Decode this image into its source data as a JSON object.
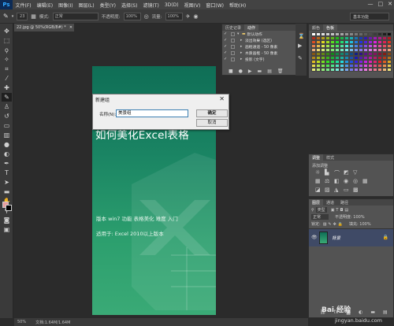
{
  "app": {
    "logo": "Ps",
    "menu": [
      "文件(F)",
      "编辑(E)",
      "图像(I)",
      "图层(L)",
      "类型(Y)",
      "选择(S)",
      "滤镜(T)",
      "3D(D)",
      "视图(V)",
      "窗口(W)",
      "帮助(H)"
    ],
    "window_controls": [
      "—",
      "□",
      "✕"
    ]
  },
  "options": {
    "brush_size": "23",
    "mode_label": "模式:",
    "mode_value": "正常",
    "opacity_label": "不透明度:",
    "opacity_value": "100%",
    "flow_label": "流量:",
    "flow_value": "100%",
    "workspace": "基本功能"
  },
  "document": {
    "tab": "22.jpg @ 50%(RGB/8#) *",
    "canvas_title": "如何美化Excel表格",
    "canvas_line1": "版本 win7   功能 表格美化   难度 入门",
    "canvas_line2": "适用于:  Excel 2010以上版本"
  },
  "dialog": {
    "title": "新建组",
    "close": "✕",
    "name_label": "名称(N):",
    "name_value": "美景组",
    "ok": "确定",
    "cancel": "取消"
  },
  "history": {
    "tabs": [
      "历史记录",
      "动作"
    ],
    "rows": [
      {
        "check": "✓",
        "arrow": "▾",
        "text": "默认动作"
      },
      {
        "check": "✓",
        "arrow": "▸",
        "text": "淡出效果 (选区)"
      },
      {
        "check": "✓",
        "arrow": "▸",
        "text": "画框通道 - 50 像素"
      },
      {
        "check": "✓",
        "arrow": "▸",
        "text": "木质画框 - 50 像素"
      },
      {
        "check": "✓",
        "arrow": "▸",
        "text": "投影 (文字)"
      }
    ]
  },
  "swatches": {
    "tabs": [
      "颜色",
      "色板"
    ]
  },
  "adjustments": {
    "tabs": [
      "调整",
      "样式"
    ],
    "subtitle": "添加调整"
  },
  "layers": {
    "tabs": [
      "图层",
      "通道",
      "路径"
    ],
    "filter_label": "类型",
    "blend_mode": "正常",
    "opacity": "不透明度: 100%",
    "lock_label": "锁定:",
    "fill": "填充: 100%",
    "layer_name": "背景"
  },
  "status": {
    "zoom": "50%",
    "doc_size": "文档:1.64M/1.64M"
  },
  "watermark": {
    "brand": "Bai 经验",
    "url": "jingyan.baidu.com"
  }
}
